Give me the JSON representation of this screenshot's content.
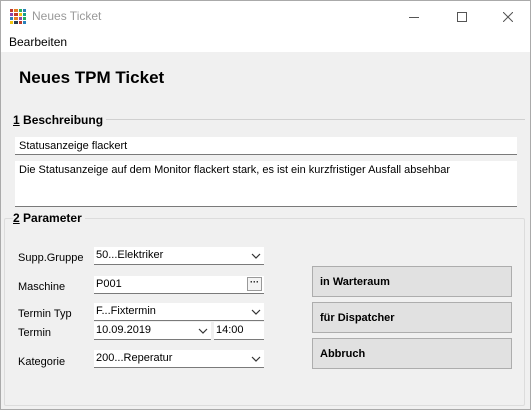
{
  "window": {
    "title": "Neues Ticket"
  },
  "menu": {
    "items": [
      "Bearbeiten"
    ]
  },
  "heading": "Neues TPM Ticket",
  "section1": {
    "number": "1",
    "title": "Beschreibung"
  },
  "description": {
    "summary": "Statusanzeige flackert",
    "details": "Die Statusanzeige auf dem Monitor flackert stark, es ist ein kurzfristiger Ausfall absehbar"
  },
  "section2": {
    "number": "2",
    "title": "Parameter"
  },
  "params": {
    "supp_gruppe": {
      "label": "Supp.Gruppe",
      "value": "50...Elektriker"
    },
    "maschine": {
      "label": "Maschine",
      "value": "P001",
      "browse_label": "···"
    },
    "termin_typ": {
      "label": "Termin Typ",
      "value": "F...Fixtermin"
    },
    "termin": {
      "label": "Termin",
      "date": "10.09.2019",
      "time": "14:00"
    },
    "kategorie": {
      "label": "Kategorie",
      "value": "200...Reperatur"
    }
  },
  "buttons": {
    "warteraum": "in Warteraum",
    "dispatcher": "für Dispatcher",
    "abbruch": "Abbruch"
  },
  "colors": {
    "titlebar_bg": "#ffffff",
    "window_bg": "#f0f0f0",
    "button_bg": "#e1e1e1"
  }
}
